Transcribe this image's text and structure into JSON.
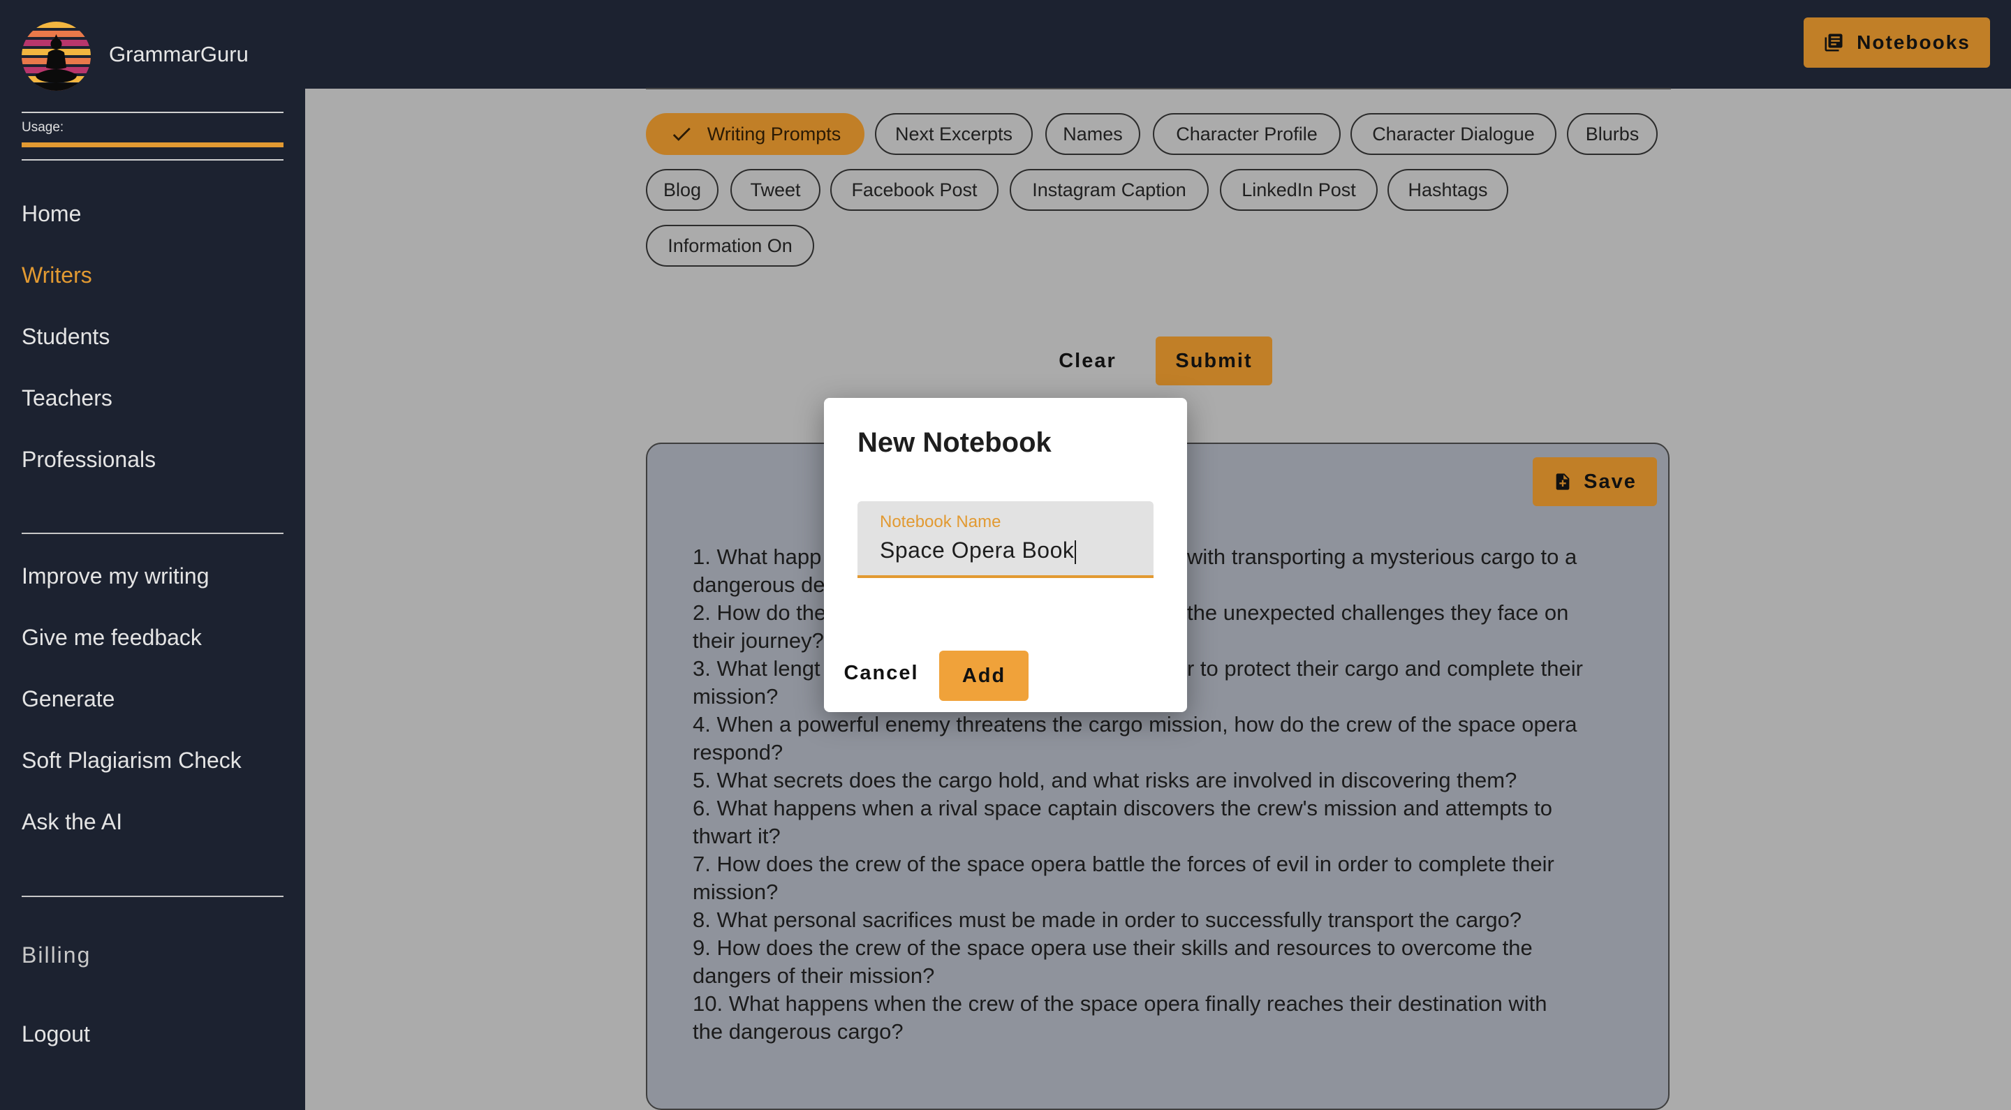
{
  "app": {
    "name": "GrammarGuru",
    "logo_icon": "meditation-logo-icon"
  },
  "usage": {
    "label": "Usage:",
    "fraction": 1.0,
    "color": "#e29a32"
  },
  "sidebar": {
    "primary": [
      {
        "label": "Home"
      },
      {
        "label": "Writers",
        "active": true
      },
      {
        "label": "Students"
      },
      {
        "label": "Teachers"
      },
      {
        "label": "Professionals"
      }
    ],
    "secondary": [
      {
        "label": "Improve my writing"
      },
      {
        "label": "Give me feedback"
      },
      {
        "label": "Generate"
      },
      {
        "label": "Soft Plagiarism Check"
      },
      {
        "label": "Ask the AI"
      }
    ],
    "billing": "Billing",
    "logout": "Logout"
  },
  "header": {
    "notebooks_label": "Notebooks",
    "notebooks_icon": "notebook-icon"
  },
  "chips": [
    {
      "label": "Writing Prompts",
      "selected": true
    },
    {
      "label": "Next Excerpts"
    },
    {
      "label": "Names"
    },
    {
      "label": "Character Profile"
    },
    {
      "label": "Character Dialogue"
    },
    {
      "label": "Blurbs"
    },
    {
      "label": "Blog"
    },
    {
      "label": "Tweet"
    },
    {
      "label": "Facebook Post"
    },
    {
      "label": "Instagram Caption"
    },
    {
      "label": "LinkedIn Post"
    },
    {
      "label": "Hashtags"
    },
    {
      "label": "Information On"
    }
  ],
  "actions": {
    "clear": "Clear",
    "submit": "Submit"
  },
  "output": {
    "save_label": "Save",
    "lines": [
      "1. What happ",
      "dangerous de",
      "2. How do the",
      "their journey?",
      "3. What lengt",
      "mission?",
      "4. When a powerful enemy threatens the cargo mission, how do the crew of the space opera",
      "respond?",
      "5. What secrets does the cargo hold, and what risks are involved in discovering them?",
      "6. What happens when a rival space captain discovers the crew's mission and attempts to",
      "thwart it?",
      "7. How does the crew of the space opera battle the forces of evil in order to complete their",
      "mission?",
      "8. What personal sacrifices must be made in order to successfully transport the cargo?",
      "9. How does the crew of the space opera use their skills and resources to overcome the",
      "dangers of their mission?",
      "10. What happens when the crew of the space opera finally reaches their destination with",
      "the dangerous cargo?"
    ],
    "partial_right": [
      "with transporting a mysterious cargo to a",
      "the unexpected challenges they face on",
      "r to protect their cargo and complete their"
    ]
  },
  "dialog": {
    "title": "New Notebook",
    "field_label": "Notebook Name",
    "field_value": "Space Opera Book",
    "cancel": "Cancel",
    "add": "Add"
  }
}
